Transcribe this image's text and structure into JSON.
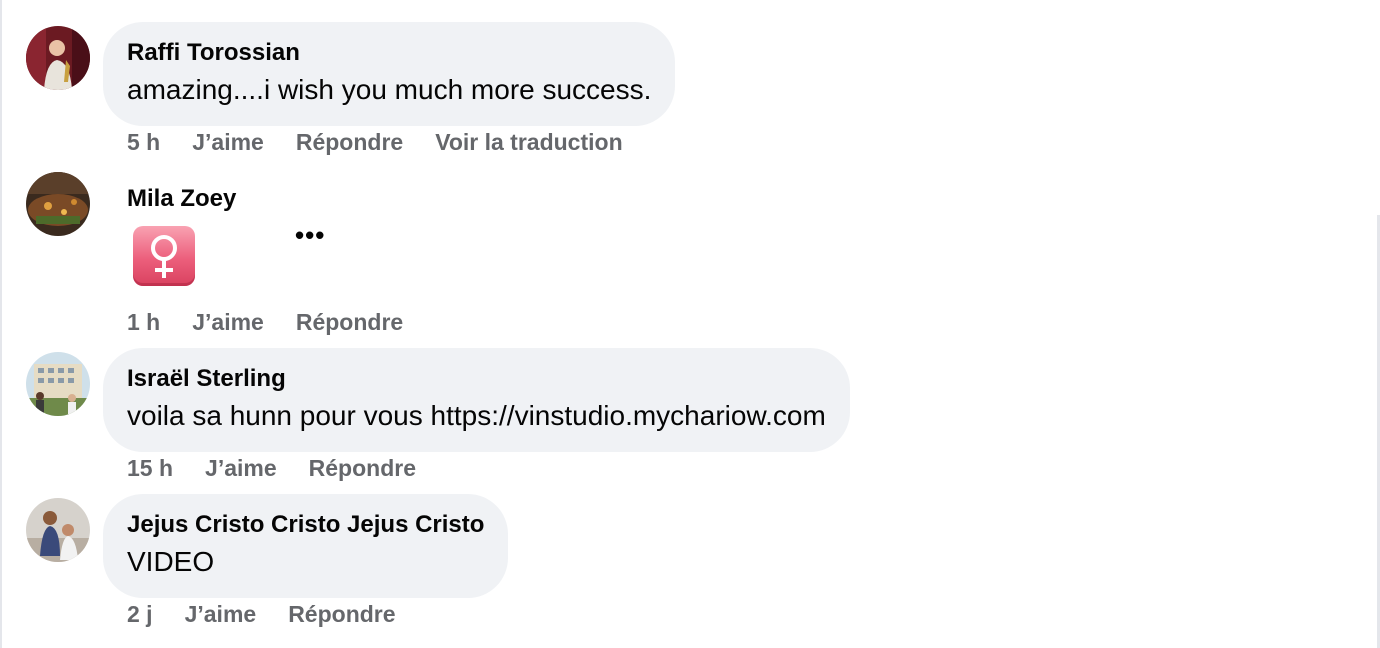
{
  "colors": {
    "bubble_bg": "#f0f2f5",
    "meta_text": "#65676b",
    "primary_text": "#050505",
    "sticker_pink": "#ec5f7c"
  },
  "comments": [
    {
      "author": "Raffi Torossian",
      "text": "amazing....i wish you much more success.",
      "time": "5 h",
      "like": "J’aime",
      "reply": "Répondre",
      "translate": "Voir la traduction",
      "avatar_icon": "person-avatar-icon"
    },
    {
      "author": "Mila Zoey",
      "sticker_icon": "female-sign-icon",
      "more_icon": "more-options-icon",
      "time": "1 h",
      "like": "J’aime",
      "reply": "Répondre",
      "avatar_icon": "landscape-avatar-icon"
    },
    {
      "author": "Israël Sterling",
      "text": "voila sa hunn pour vous https://vinstudio.mychariow.com",
      "time": "15 h",
      "like": "J’aime",
      "reply": "Répondre",
      "avatar_icon": "building-avatar-icon"
    },
    {
      "author": "Jejus Cristo Cristo Jejus Cristo",
      "text": "VIDEO",
      "time": "2 j",
      "like": "J’aime",
      "reply": "Répondre",
      "avatar_icon": "group-avatar-icon"
    }
  ]
}
